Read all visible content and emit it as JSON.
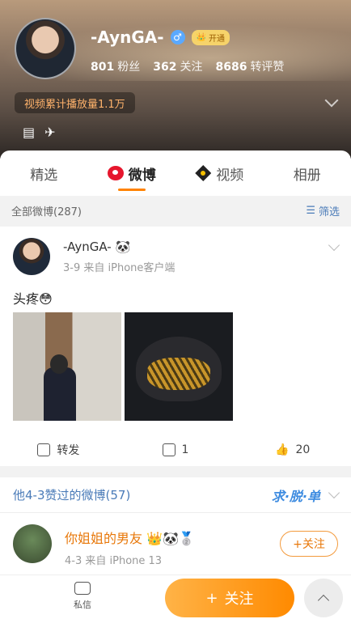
{
  "profile": {
    "name": "-AynGA-",
    "gender_icon": "♂",
    "vip_label": "开通",
    "fans_count": "801",
    "fans_label": "粉丝",
    "follow_count": "362",
    "follow_label": "关注",
    "repost_count": "8686",
    "repost_label": "转评赞",
    "play_stat": "视频累计播放量1.1万"
  },
  "tabs": [
    {
      "label": "精选"
    },
    {
      "label": "微博"
    },
    {
      "label": "视频"
    },
    {
      "label": "相册"
    }
  ],
  "filter": {
    "all_label": "全部微博(287)",
    "filter_label": "筛选"
  },
  "post": {
    "author": "-AynGA- 🐼",
    "meta": "3-9  来自 iPhone客户端",
    "text": "头疼😳",
    "repost_label": "转发",
    "comment_count": "1",
    "like_count": "20"
  },
  "liked": {
    "title": "他4-3赞过的微博(57)",
    "deco": "求·脱·单"
  },
  "post2": {
    "author": "你姐姐的男友 👑🐼🥈",
    "meta": "4-3  来自 iPhone 13",
    "follow_label": "+关注"
  },
  "bottom": {
    "message_label": "私信",
    "follow_label": "关注",
    "follow_plus": "+"
  }
}
